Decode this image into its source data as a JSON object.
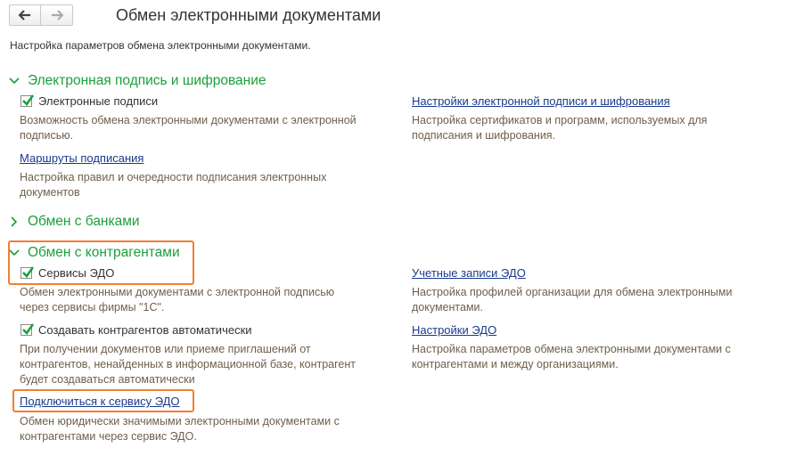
{
  "nav": {
    "back_icon": "arrow-left-icon",
    "forward_icon": "arrow-right-icon"
  },
  "page": {
    "title": "Обмен электронными документами",
    "subtitle": "Настройка параметров обмена электронными документами."
  },
  "sections": {
    "signature": {
      "title": "Электронная подпись и шифрование",
      "expanded": true,
      "checkbox_label": "Электронные подписи",
      "checkbox_checked": true,
      "checkbox_desc": "Возможность обмена электронными документами с электронной подписью.",
      "routes_link": "Маршруты подписания",
      "routes_desc": "Настройка правил и очередности подписания электронных документов",
      "settings_link": "Настройки электронной подписи и шифрования",
      "settings_desc": "Настройка сертификатов и программ, используемых для подписания и шифрования."
    },
    "banks": {
      "title": "Обмен с банками",
      "expanded": false
    },
    "contractors": {
      "title": "Обмен с контрагентами",
      "expanded": true,
      "edo_label": "Сервисы ЭДО",
      "edo_checked": true,
      "edo_desc": "Обмен электронными документами с электронной подписью через сервисы фирмы \"1С\".",
      "auto_label": "Создавать контрагентов автоматически",
      "auto_checked": true,
      "auto_desc": "При получении документов или приеме приглашений от контрагентов, ненайденных в информационной базе, контрагент будет создаваться автоматически",
      "connect_link": "Подключиться к сервису ЭДО",
      "connect_desc": "Обмен юридически значимыми электронными документами с контрагентами через сервис ЭДО.",
      "accounts_link": "Учетные записи ЭДО",
      "accounts_desc": "Настройка профилей организации для обмена электронными документами.",
      "edo_settings_link": "Настройки ЭДО",
      "edo_settings_desc": "Настройка параметров обмена электронными документами с контрагентами и между организациями."
    }
  },
  "colors": {
    "section": "#1c9f3b",
    "link": "#1a3a8f",
    "desc": "#6e5f4a",
    "highlight": "#f07f33",
    "check": "#1c9f3b"
  }
}
